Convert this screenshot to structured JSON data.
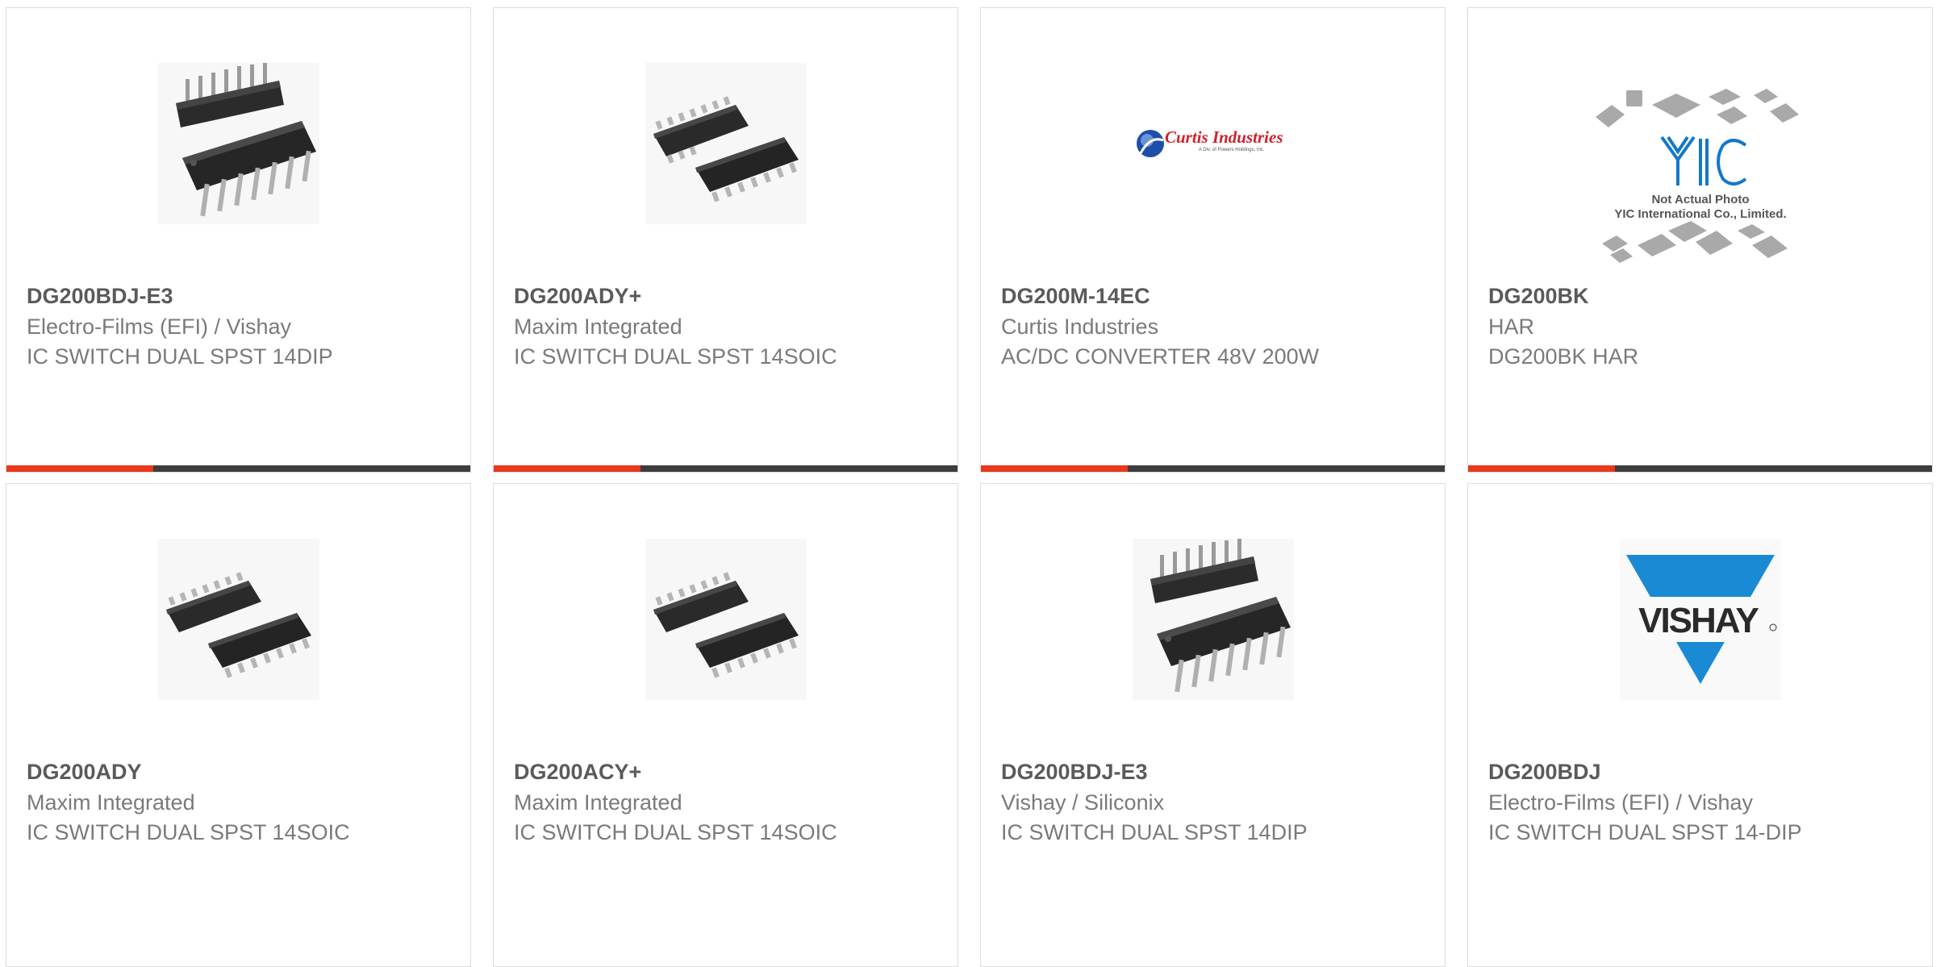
{
  "colors": {
    "accent_bar": "#e8391a",
    "dark_bar": "#3d3d3d",
    "card_border": "#dcdcdc",
    "part_text": "#5a5a5a",
    "secondary_text": "#7a7a7a",
    "vishay_blue": "#1a8ad4",
    "yic_blue": "#1478c8",
    "curtis_red": "#d0212b"
  },
  "products": [
    {
      "part": "DG200BDJ-E3",
      "manufacturer": "Electro-Films (EFI) / Vishay",
      "description": "IC SWITCH DUAL SPST 14DIP",
      "image": "dip14-chip-icon"
    },
    {
      "part": "DG200ADY+",
      "manufacturer": "Maxim Integrated",
      "description": "IC SWITCH DUAL SPST 14SOIC",
      "image": "soic14-chip-icon"
    },
    {
      "part": "DG200M-14EC",
      "manufacturer": "Curtis Industries",
      "description": "AC/DC CONVERTER 48V 200W",
      "image": "curtis-logo",
      "logo_text": "Curtis Industries",
      "logo_subtext": "A Div. of Powers Holdings, Inc."
    },
    {
      "part": "DG200BK",
      "manufacturer": "HAR",
      "description": "DG200BK HAR",
      "image": "yic-placeholder",
      "logo_text": "YIC",
      "placeholder_line1": "Not Actual Photo",
      "placeholder_line2": "YIC International Co., Limited."
    },
    {
      "part": "DG200ADY",
      "manufacturer": "Maxim Integrated",
      "description": "IC SWITCH DUAL SPST 14SOIC",
      "image": "soic14-chip-icon"
    },
    {
      "part": "DG200ACY+",
      "manufacturer": "Maxim Integrated",
      "description": "IC SWITCH DUAL SPST 14SOIC",
      "image": "soic14-chip-icon"
    },
    {
      "part": "DG200BDJ-E3",
      "manufacturer": "Vishay / Siliconix",
      "description": "IC SWITCH DUAL SPST 14DIP",
      "image": "dip14-chip-icon"
    },
    {
      "part": "DG200BDJ",
      "manufacturer": "Electro-Films (EFI) / Vishay",
      "description": "IC SWITCH DUAL SPST 14-DIP",
      "image": "vishay-logo",
      "logo_text": "VISHAY"
    }
  ]
}
